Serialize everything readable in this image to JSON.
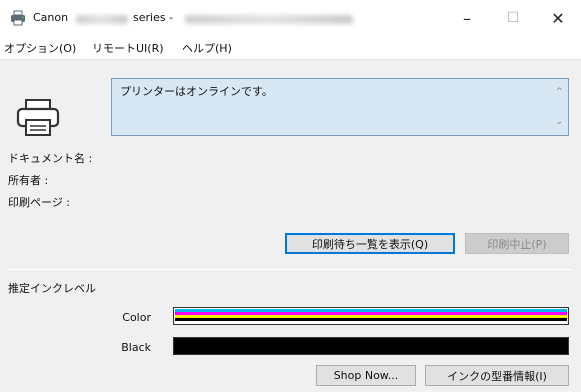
{
  "titlebar": {
    "app_name": "Canon",
    "series_label": "series -",
    "icon": "canon-printer-app-icon",
    "minimize_icon": "minimize-icon",
    "maximize_icon": "maximize-icon",
    "close_icon": "close-icon",
    "minimize_glyph": "–",
    "maximize_glyph": "☐",
    "close_glyph": "✕"
  },
  "menu": {
    "items": [
      {
        "label": "オプション(O)"
      },
      {
        "label": "リモートUI(R)"
      },
      {
        "label": "ヘルプ(H)"
      }
    ]
  },
  "status": {
    "icon": "printer-icon",
    "message": "プリンターはオンラインです。",
    "scroll_up": "^",
    "scroll_down": "⌄"
  },
  "job": {
    "document_name_label": "ドキュメント名 :",
    "owner_label": "所有者 :",
    "printing_page_label": "印刷ページ :"
  },
  "buttons": {
    "show_queue": "印刷待ち一覧を表示(Q)",
    "cancel_print": "印刷中止(P)",
    "shop_now": "Shop Now...",
    "ink_info": "インクの型番情報(I)"
  },
  "ink": {
    "section_label": "推定インクレベル",
    "color_label": "Color",
    "black_label": "Black",
    "color_level": 1.0,
    "black_level": 1.0,
    "colors": {
      "cyan": "#00b7f1",
      "magenta": "#ff00ff",
      "yellow": "#ffef00",
      "black": "#000000"
    }
  },
  "theme": {
    "window_bg": "#f0f0f0",
    "status_bg": "#d8e7f4",
    "accent": "#0078d7"
  }
}
